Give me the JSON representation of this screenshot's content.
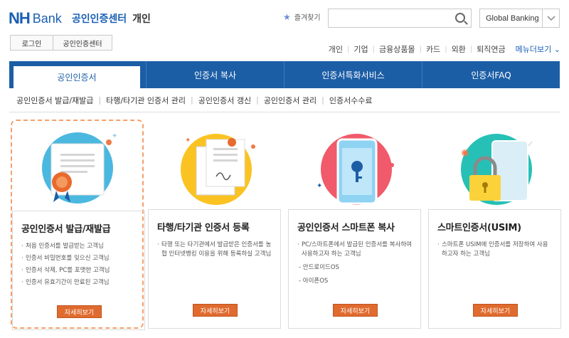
{
  "header": {
    "logo_nh": "NH",
    "logo_bank": "Bank",
    "logo_center": "공인인증센터",
    "logo_personal": "개인",
    "favorites": "즐겨찾기",
    "search_placeholder": "",
    "global_banking": "Global Banking",
    "login": "로그인",
    "cert_center": "공인인증센터",
    "util_links": [
      "개인",
      "기업",
      "금융상품몰",
      "카드",
      "외환",
      "퇴직연금"
    ],
    "menu_all": "메뉴더보기 ⌄"
  },
  "tabs": [
    {
      "label": "공인인증서",
      "active": true
    },
    {
      "label": "인증서 복사",
      "active": false
    },
    {
      "label": "인증서특화서비스",
      "active": false
    },
    {
      "label": "인증서FAQ",
      "active": false
    }
  ],
  "subnav": [
    "공인인증서 발급/재발급",
    "타행/타기관 인증서 관리",
    "공인인증서 갱신",
    "공인인증서 관리",
    "인증서수수료"
  ],
  "cards": [
    {
      "title": "공인인증서 발급/재발급",
      "items": [
        "처음 인증서를 발급받는 고객님",
        "인증서 비밀번호를 잊으신 고객님",
        "인증서 삭제, PC를 포맷한 고객님",
        "인증서 유효기간이 만료된 고객님"
      ],
      "button": "자세히보기"
    },
    {
      "title": "타행/타기관 인증서 등록",
      "items": [
        "타행 또는 타기관에서 발급받은 인증서를 농협 인터넷뱅킹 이용을 위해 등록하실 고객님"
      ],
      "button": "자세히보기"
    },
    {
      "title": "공인인증서 스마트폰 복사",
      "items": [
        "PC/스마트폰에서 발급된 인증서를 복사하여 사용하고자 하는 고객님"
      ],
      "sub": [
        "- 안드로이드OS",
        "- 아이폰OS"
      ],
      "button": "자세히보기"
    },
    {
      "title": "스마트인증서(USIM)",
      "items": [
        "스마트폰 USIM에 인증서를 저장하여 사용하고자 하는 고객님"
      ],
      "button": "자세히보기"
    }
  ],
  "colors": {
    "brand_blue": "#1c5ea6",
    "accent_orange": "#e06b2e"
  }
}
